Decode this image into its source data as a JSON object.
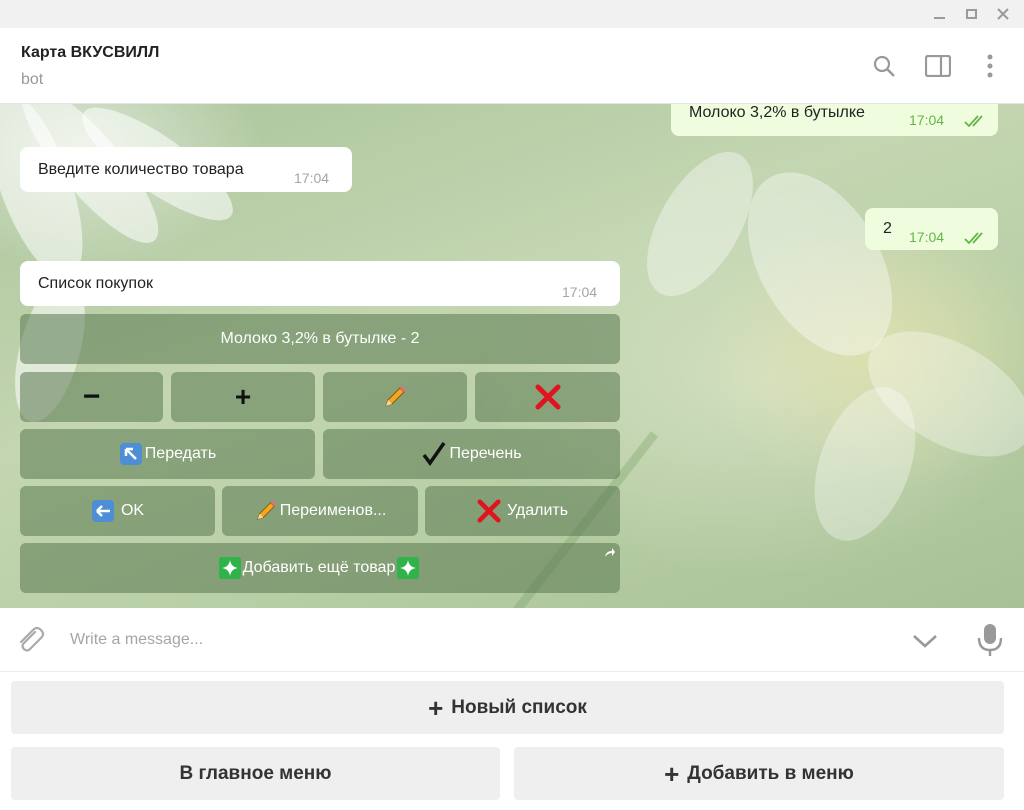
{
  "chat": {
    "title": "Карта ВКУСВИЛЛ",
    "subtitle": "bot"
  },
  "messages": [
    {
      "text": "Молоко 3,2% в бутылке",
      "time": "17:04",
      "direction": "out"
    },
    {
      "text": "Введите количество товара",
      "time": "17:04",
      "direction": "in"
    },
    {
      "text": "2",
      "time": "17:04",
      "direction": "out"
    },
    {
      "text": "Список покупок",
      "time": "17:04",
      "direction": "in"
    }
  ],
  "inline_keyboard": {
    "item": "Молоко 3,2% в бутылке - 2",
    "minus": "−",
    "plus": "+",
    "edit_icon": "pencil-icon",
    "delete_icon": "cross-mark-icon",
    "transfer": "Передать",
    "list": "Перечень",
    "ok": "OK",
    "rename": "Переименов...",
    "delete": "Удалить",
    "add_more": "Добавить ещё товар"
  },
  "composer": {
    "placeholder": "Write a message..."
  },
  "reply_keyboard": {
    "new_list": "Новый список",
    "main_menu": "В главное меню",
    "add_to_menu": "Добавить в меню"
  },
  "colors": {
    "outgoing_bubble": "#effdde",
    "incoming_bubble": "#ffffff",
    "checkmark": "#63b548",
    "keyboard_button": "#5a7850",
    "delete_red": "#e0141e"
  }
}
